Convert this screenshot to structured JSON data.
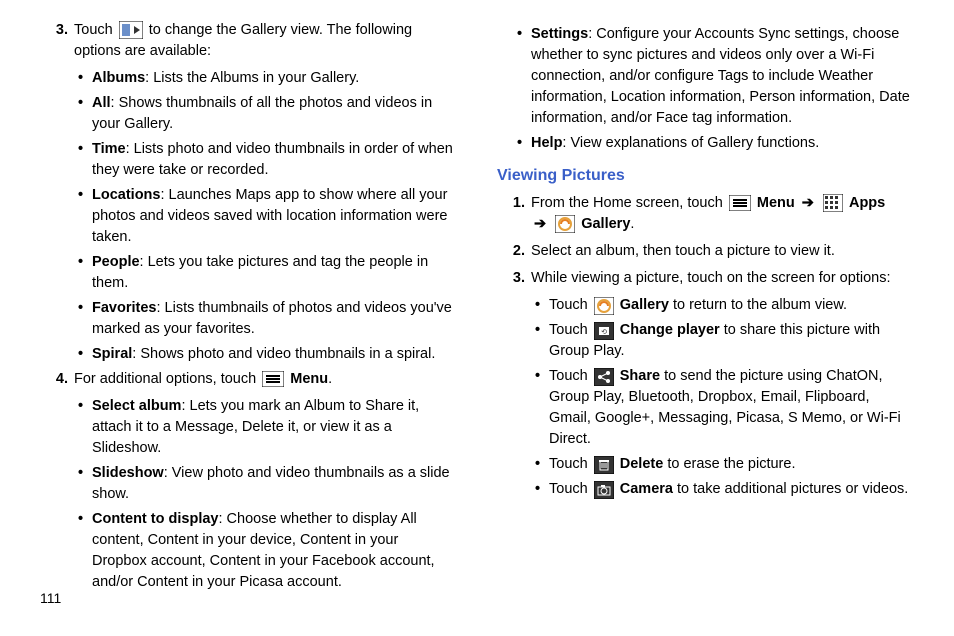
{
  "pageNumber": "111",
  "left": {
    "step3": {
      "num": "3.",
      "prefix": "Touch ",
      "suffix": " to change the Gallery view. The following options are available:",
      "items": [
        {
          "label": "Albums",
          "desc": ": Lists the Albums in your Gallery."
        },
        {
          "label": "All",
          "desc": ": Shows thumbnails of all the photos and videos in your Gallery."
        },
        {
          "label": "Time",
          "desc": ": Lists photo and video thumbnails in order of when they were take or recorded."
        },
        {
          "label": "Locations",
          "desc": ": Launches Maps app to show where all your photos and videos saved with location information were taken."
        },
        {
          "label": "People",
          "desc": ": Lets you take pictures and tag the people in them."
        },
        {
          "label": "Favorites",
          "desc": ": Lists thumbnails of photos and videos you've marked as your favorites."
        },
        {
          "label": "Spiral",
          "desc": ": Shows photo and video thumbnails in a spiral."
        }
      ]
    },
    "step4": {
      "num": "4.",
      "prefix": "For additional options, touch ",
      "menuLabel": " Menu",
      "suffix": ".",
      "items": [
        {
          "label": "Select album",
          "desc": ": Lets you mark an Album to Share it, attach it to a Message, Delete it, or view it as a Slideshow."
        },
        {
          "label": "Slideshow",
          "desc": ": View photo and video thumbnails as a slide show."
        },
        {
          "label": "Content to display",
          "desc": ": Choose whether to display All content, Content in your device, Content in your Dropbox account, Content in your Facebook account, and/or Content in your Picasa account."
        }
      ]
    }
  },
  "right": {
    "contItems": [
      {
        "label": "Settings",
        "desc": ": Configure your Accounts Sync settings, choose whether to sync pictures and videos only over a Wi-Fi connection, and/or configure Tags to include Weather information, Location information, Person information, Date information, and/or Face tag information."
      },
      {
        "label": "Help",
        "desc": ": View explanations of Gallery functions."
      }
    ],
    "heading": "Viewing Pictures",
    "step1": {
      "num": "1.",
      "text": "From the Home screen, touch ",
      "menuLabel": " Menu",
      "arrow": "➔",
      "appsLabel": " Apps",
      "galleryLabel": " Gallery",
      "period": "."
    },
    "step2": {
      "num": "2.",
      "text": "Select an album, then touch a picture to view it."
    },
    "step3": {
      "num": "3.",
      "text": "While viewing a picture, touch on the screen for options:",
      "items": [
        {
          "prefix": "Touch ",
          "label": " Gallery",
          "desc": " to return to the album view."
        },
        {
          "prefix": "Touch ",
          "label": " Change player",
          "desc": " to share this picture with Group Play."
        },
        {
          "prefix": "Touch ",
          "label": " Share",
          "desc": " to send the picture using ChatON, Group Play, Bluetooth, Dropbox, Email, Flipboard, Gmail, Google+, Messaging, Picasa, S Memo, or Wi-Fi Direct."
        },
        {
          "prefix": "Touch ",
          "label": " Delete",
          "desc": " to erase the picture."
        },
        {
          "prefix": "Touch ",
          "label": " Camera",
          "desc": " to take additional pictures or videos."
        }
      ]
    }
  }
}
